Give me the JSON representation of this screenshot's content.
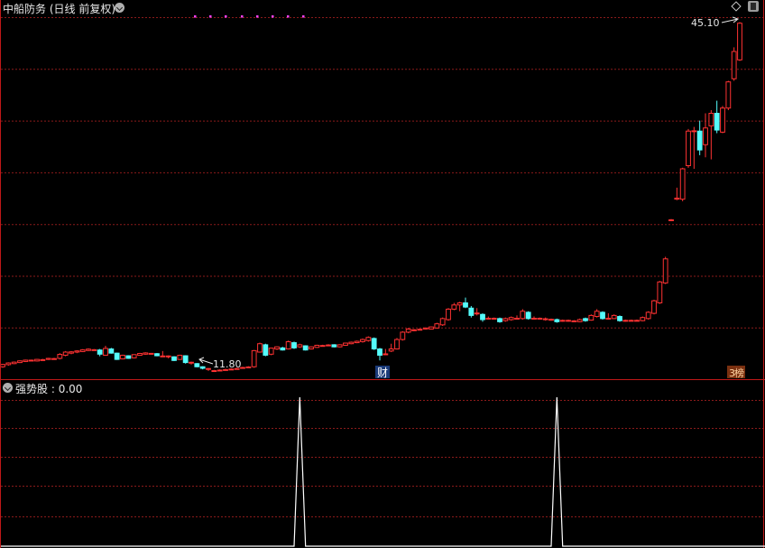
{
  "header": {
    "title": "中船防务",
    "mode": "(日线 前复权)"
  },
  "indicator": {
    "name": "强势股",
    "value_text": "0.00"
  },
  "annotations": {
    "high_label": "45.10",
    "low_label": "11.80",
    "badge_cai": "财",
    "badge_bang": "榜"
  },
  "colors": {
    "background": "#000000",
    "up_candle": "#ff3232",
    "down_candle": "#54fcfc",
    "grid": "#8b1a1a",
    "divider": "#c01818",
    "indicator_line": "#ffffff",
    "marker_dots": "#ff44ff"
  },
  "icons": [
    "chevron-down-icon",
    "diamond-icon",
    "window-icon"
  ],
  "chart_data": [
    {
      "type": "candlestick",
      "ylim": [
        11.2,
        46.8
      ],
      "grid": true,
      "candles": [
        [
          12.3,
          12.52,
          12.2,
          12.58
        ],
        [
          12.5,
          12.66,
          12.4,
          12.72
        ],
        [
          12.6,
          12.74,
          12.55,
          12.8
        ],
        [
          12.7,
          12.86,
          12.65,
          12.9
        ],
        [
          12.8,
          12.93,
          12.75,
          12.98
        ],
        [
          12.9,
          12.93,
          12.85,
          12.98
        ],
        [
          12.85,
          13.0,
          12.8,
          13.05
        ],
        [
          12.95,
          12.98,
          12.9,
          13.05
        ],
        [
          13.0,
          13.1,
          12.95,
          13.15
        ],
        [
          13.05,
          13.08,
          13.0,
          13.15
        ],
        [
          13.1,
          13.48,
          13.0,
          13.6
        ],
        [
          13.4,
          13.7,
          13.3,
          13.8
        ],
        [
          13.6,
          13.72,
          13.5,
          13.8
        ],
        [
          13.7,
          13.81,
          13.6,
          13.88
        ],
        [
          13.75,
          13.91,
          13.7,
          13.98
        ],
        [
          13.85,
          13.98,
          13.8,
          14.05
        ],
        [
          13.9,
          13.93,
          13.85,
          13.98
        ],
        [
          13.9,
          13.5,
          13.3,
          14.0
        ],
        [
          13.4,
          14.05,
          13.35,
          14.3
        ],
        [
          14.0,
          13.6,
          13.55,
          14.1
        ],
        [
          13.6,
          13.0,
          12.95,
          13.65
        ],
        [
          13.05,
          13.4,
          13.0,
          13.45
        ],
        [
          13.35,
          13.1,
          13.05,
          13.4
        ],
        [
          13.15,
          13.46,
          13.1,
          13.5
        ],
        [
          13.4,
          13.57,
          13.35,
          13.62
        ],
        [
          13.5,
          13.62,
          13.45,
          13.68
        ],
        [
          13.55,
          13.58,
          13.45,
          13.62
        ],
        [
          13.55,
          13.35,
          13.3,
          13.6
        ],
        [
          13.3,
          13.33,
          13.25,
          13.8
        ],
        [
          13.3,
          13.33,
          13.1,
          13.38
        ],
        [
          13.25,
          12.9,
          12.85,
          13.3
        ],
        [
          13.0,
          13.4,
          12.95,
          13.45
        ],
        [
          13.35,
          12.7,
          12.6,
          13.4
        ],
        [
          12.7,
          12.73,
          12.5,
          12.78
        ],
        [
          12.6,
          12.3,
          12.25,
          12.65
        ],
        [
          12.3,
          12.15,
          12.05,
          12.35
        ],
        [
          12.1,
          12.13,
          11.9,
          12.18
        ],
        [
          11.9,
          11.93,
          11.8,
          12.0
        ],
        [
          11.95,
          11.98,
          11.9,
          12.05
        ],
        [
          12.0,
          12.03,
          11.95,
          12.1
        ],
        [
          12.05,
          12.08,
          12.0,
          12.15
        ],
        [
          12.1,
          12.13,
          12.05,
          12.2
        ],
        [
          12.2,
          12.23,
          12.1,
          12.3
        ],
        [
          12.25,
          12.28,
          12.2,
          12.35
        ],
        [
          12.3,
          13.84,
          12.2,
          13.9
        ],
        [
          13.7,
          14.5,
          13.65,
          14.6
        ],
        [
          14.4,
          13.4,
          13.3,
          14.5
        ],
        [
          13.5,
          14.08,
          13.4,
          14.1
        ],
        [
          14.0,
          14.2,
          13.9,
          14.25
        ],
        [
          14.1,
          13.9,
          13.85,
          14.2
        ],
        [
          14.0,
          14.69,
          13.95,
          14.8
        ],
        [
          14.6,
          14.1,
          14.0,
          14.7
        ],
        [
          14.2,
          14.4,
          14.1,
          14.5
        ],
        [
          14.3,
          13.9,
          13.85,
          14.35
        ],
        [
          14.0,
          14.2,
          13.95,
          14.25
        ],
        [
          14.15,
          14.35,
          14.1,
          14.4
        ],
        [
          14.3,
          14.33,
          14.25,
          14.4
        ],
        [
          14.35,
          14.38,
          14.3,
          14.45
        ],
        [
          14.4,
          14.2,
          14.15,
          14.45
        ],
        [
          14.2,
          14.4,
          14.15,
          14.45
        ],
        [
          14.35,
          14.56,
          14.3,
          14.6
        ],
        [
          14.5,
          14.64,
          14.45,
          14.7
        ],
        [
          14.6,
          14.73,
          14.55,
          14.8
        ],
        [
          14.7,
          14.9,
          14.6,
          15.0
        ],
        [
          14.8,
          15.1,
          14.7,
          15.2
        ],
        [
          15.0,
          14.0,
          13.9,
          15.1
        ],
        [
          14.0,
          13.4,
          12.9,
          14.1
        ],
        [
          13.5,
          13.53,
          13.4,
          14.0
        ],
        [
          13.8,
          14.0,
          13.7,
          14.5
        ],
        [
          14.0,
          14.9,
          13.95,
          15.05
        ],
        [
          14.9,
          15.6,
          14.8,
          15.7
        ],
        [
          15.6,
          15.9,
          15.5,
          16.0
        ],
        [
          15.8,
          15.83,
          15.7,
          15.9
        ],
        [
          15.85,
          15.88,
          15.8,
          15.95
        ],
        [
          15.9,
          16.0,
          15.85,
          16.05
        ],
        [
          15.9,
          16.1,
          15.85,
          16.15
        ],
        [
          16.0,
          16.4,
          15.95,
          16.5
        ],
        [
          16.3,
          16.9,
          16.2,
          17.0
        ],
        [
          16.8,
          17.8,
          16.7,
          17.9
        ],
        [
          17.8,
          18.2,
          17.7,
          18.4
        ],
        [
          18.2,
          18.4,
          17.6,
          18.5
        ],
        [
          18.4,
          18.0,
          17.9,
          18.9
        ],
        [
          17.9,
          17.2,
          17.0,
          18.1
        ],
        [
          17.4,
          17.43,
          17.2,
          17.9
        ],
        [
          17.3,
          16.8,
          16.6,
          17.4
        ],
        [
          16.9,
          16.93,
          16.8,
          17.1
        ],
        [
          16.9,
          16.93,
          16.8,
          17.0
        ],
        [
          16.9,
          16.6,
          16.5,
          17.0
        ],
        [
          16.7,
          16.9,
          16.6,
          17.0
        ],
        [
          16.8,
          17.0,
          16.7,
          17.1
        ],
        [
          16.9,
          16.93,
          16.8,
          17.2
        ],
        [
          16.9,
          17.6,
          16.8,
          17.8
        ],
        [
          17.5,
          16.9,
          16.8,
          17.6
        ],
        [
          16.9,
          16.93,
          16.8,
          17.1
        ],
        [
          16.9,
          16.93,
          16.8,
          17.0
        ],
        [
          16.85,
          16.88,
          16.7,
          17.0
        ],
        [
          16.8,
          16.83,
          16.7,
          16.9
        ],
        [
          16.8,
          16.6,
          16.5,
          16.9
        ],
        [
          16.7,
          16.73,
          16.6,
          16.8
        ],
        [
          16.7,
          16.73,
          16.6,
          16.8
        ],
        [
          16.65,
          16.68,
          16.6,
          16.75
        ],
        [
          16.6,
          16.8,
          16.55,
          16.9
        ],
        [
          16.9,
          16.7,
          16.6,
          17.0
        ],
        [
          16.75,
          17.2,
          16.7,
          17.3
        ],
        [
          17.1,
          17.6,
          17.0,
          17.8
        ],
        [
          17.5,
          16.9,
          16.8,
          17.6
        ],
        [
          16.9,
          16.93,
          16.8,
          17.4
        ],
        [
          16.9,
          17.2,
          16.85,
          17.3
        ],
        [
          17.1,
          16.7,
          16.6,
          17.2
        ],
        [
          16.7,
          16.73,
          16.6,
          16.8
        ],
        [
          16.7,
          16.73,
          16.65,
          16.8
        ],
        [
          16.7,
          16.73,
          16.65,
          16.8
        ],
        [
          16.7,
          17.0,
          16.65,
          17.1
        ],
        [
          16.9,
          17.5,
          16.8,
          17.6
        ],
        [
          17.4,
          18.6,
          17.3,
          18.7
        ],
        [
          18.4,
          20.4,
          18.3,
          20.5
        ],
        [
          20.3,
          22.6,
          20.2,
          22.8
        ],
        [
          26.3,
          26.33,
          26.2,
          26.4
        ],
        [
          28.3,
          28.4,
          28.2,
          29.4
        ],
        [
          28.3,
          31.2,
          28.1,
          31.3
        ],
        [
          31.5,
          34.8,
          31.3,
          35.0
        ],
        [
          34.8,
          34.83,
          31.2,
          35.2
        ],
        [
          34.8,
          33.0,
          32.5,
          35.8
        ],
        [
          33.5,
          35.1,
          32.3,
          36.5
        ],
        [
          35.3,
          36.5,
          32.1,
          36.8
        ],
        [
          36.5,
          34.9,
          34.6,
          37.7
        ],
        [
          34.7,
          37.0,
          34.6,
          37.2
        ],
        [
          37.0,
          39.5,
          36.8,
          39.6
        ],
        [
          39.8,
          42.4,
          39.6,
          42.8
        ],
        [
          41.6,
          45.1,
          41.5,
          45.2
        ]
      ]
    },
    {
      "type": "line",
      "name": "强势股",
      "ylim": [
        0,
        1
      ],
      "x": [
        0,
        51,
        52,
        53,
        96,
        97,
        98,
        137
      ],
      "values": [
        0,
        0,
        1,
        0,
        0,
        1,
        0,
        0
      ]
    }
  ]
}
